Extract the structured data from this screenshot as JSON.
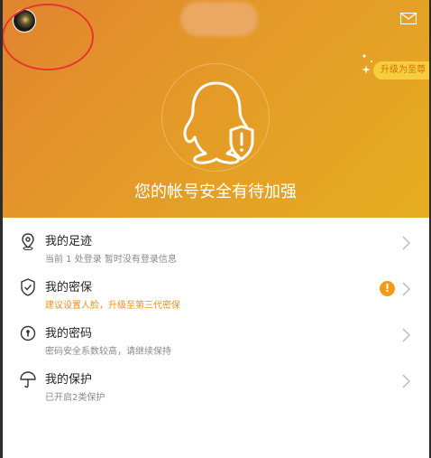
{
  "header": {
    "upgrade_label": "升级为至尊",
    "headline": "您的帐号安全有待加强"
  },
  "list": {
    "items": [
      {
        "icon": "location-pin-icon",
        "title": "我的足迹",
        "subtitle": "当前 1 处登录 暂时没有登录信息"
      },
      {
        "icon": "shield-check-icon",
        "title": "我的密保",
        "subtitle": "建议设置人脸，升级至第三代密保",
        "warning": true
      },
      {
        "icon": "keyhole-icon",
        "title": "我的密码",
        "subtitle": "密码安全系数较高，请继续保持"
      },
      {
        "icon": "umbrella-icon",
        "title": "我的保护",
        "subtitle": "已开启2类保护"
      }
    ],
    "badge": "!"
  },
  "colors": {
    "header_start": "#e0842f",
    "header_end": "#e6ad20",
    "warning": "#f0901c",
    "annotation": "#e8342e"
  }
}
